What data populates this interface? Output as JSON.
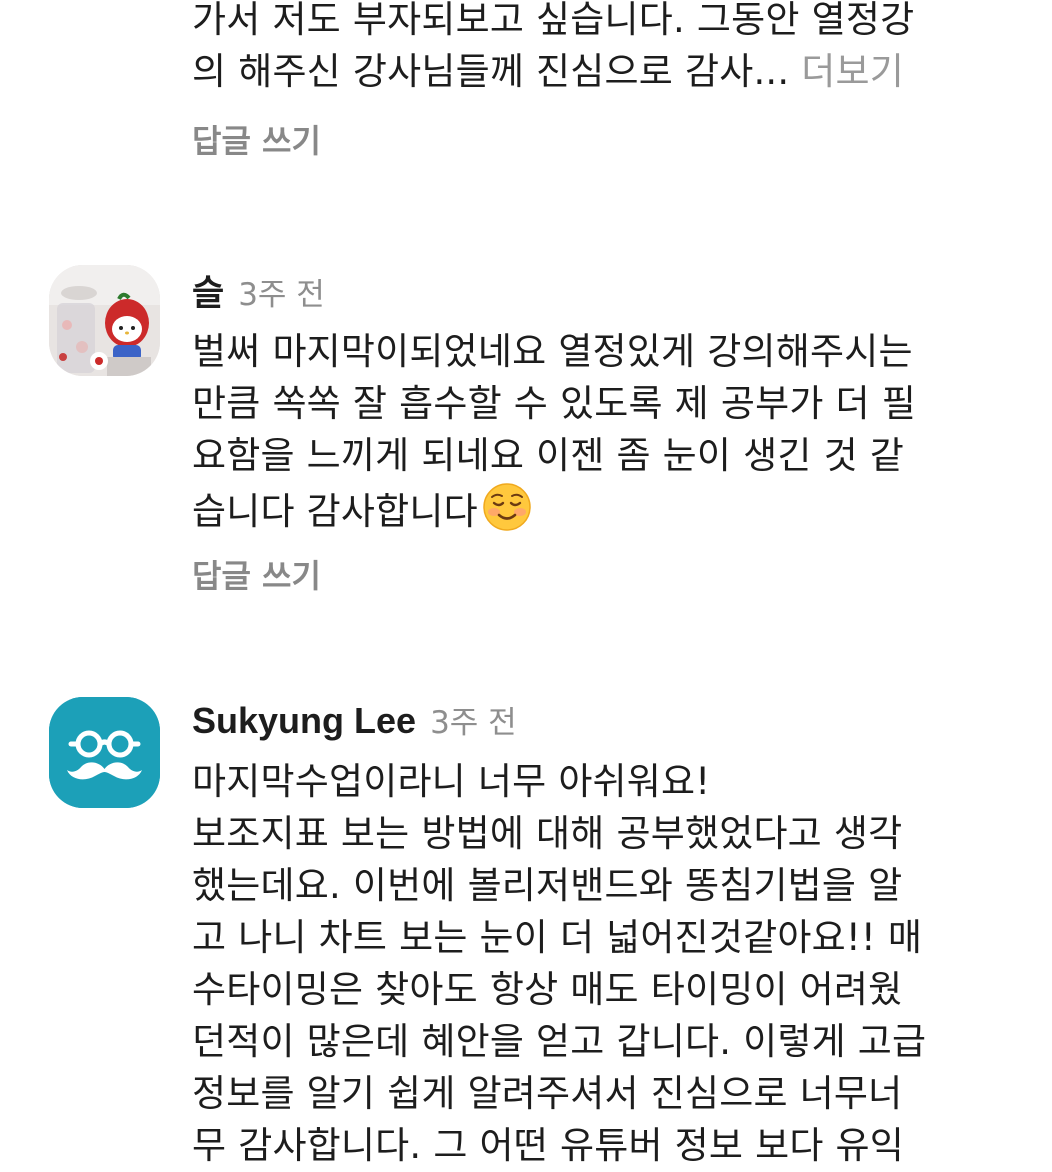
{
  "comments": [
    {
      "lines": [
        "가서 저도 부자되보고 싶습니다. 그동안 열정강",
        "의 해주신 강사님들께 진심으로 감사..."
      ],
      "more_label": "더보기",
      "reply_label": "답글 쓰기"
    },
    {
      "author": "슬",
      "time": "3주 전",
      "avatar_icon": "hello-kitty-photo",
      "lines": [
        "벌써 마지막이되었네요 열정있게 강의해주시는",
        "만큼 쏙쏙 잘 흡수할 수 있도록 제 공부가 더 필",
        "요함을 느끼게 되네요 이젠 좀 눈이 생긴 것 같",
        "습니다 감사합니다"
      ],
      "emoji": "smiling-face-emoji",
      "reply_label": "답글 쓰기"
    },
    {
      "author": "Sukyung Lee",
      "time": "3주 전",
      "avatar_icon": "glasses-mustache-icon",
      "avatar_color": "#1ca0b8",
      "lines": [
        "마지막수업이라니 너무 아쉬워요!",
        "보조지표 보는 방법에 대해 공부했었다고 생각",
        "했는데요. 이번에 볼리저밴드와 똥침기법을 알",
        "고 나니 차트 보는 눈이 더 넓어진것같아요!! 매",
        "수타이밍은 찾아도 항상 매도 타이밍이 어려웠",
        "던적이 많은데 혜안을 얻고 갑니다. 이렇게 고급",
        "정보를 알기 쉽게 알려주셔서 진심으로 너무너",
        "무 감사합니다. 그 어떤 유튜버 정보 보다 유익"
      ]
    }
  ]
}
